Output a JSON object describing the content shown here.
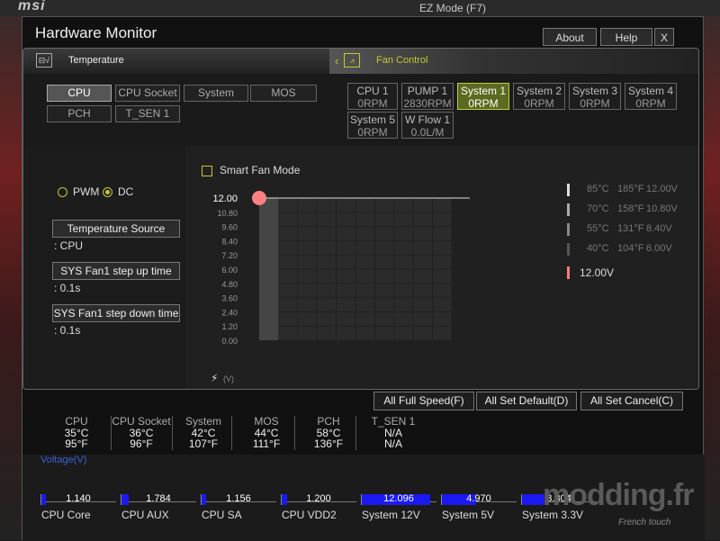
{
  "background": {
    "brand": "msi",
    "ezmode": "EZ Mode (F7)"
  },
  "window": {
    "title": "Hardware Monitor",
    "about": "About",
    "help": "Help",
    "close": "X"
  },
  "temperature_header": {
    "icon": "thermometer-icon",
    "label": "Temperature"
  },
  "fan_header": {
    "chevron": "‹",
    "label": "Fan Control"
  },
  "temp_sensors": [
    "CPU",
    "CPU Socket",
    "System",
    "MOS",
    "PCH",
    "T_SEN 1"
  ],
  "selected_temp_sensor": "CPU",
  "fans": [
    {
      "name": "CPU 1",
      "value": "0RPM"
    },
    {
      "name": "PUMP 1",
      "value": "2830RPM"
    },
    {
      "name": "System 1",
      "value": "0RPM"
    },
    {
      "name": "System 2",
      "value": "0RPM"
    },
    {
      "name": "System 3",
      "value": "0RPM"
    },
    {
      "name": "System 4",
      "value": "0RPM"
    },
    {
      "name": "System 5",
      "value": "0RPM"
    },
    {
      "name": "W Flow 1",
      "value": "0.0L/M"
    }
  ],
  "selected_fan": "System 1",
  "mode": {
    "pwm": "PWM",
    "dc": "DC",
    "selected": "DC"
  },
  "temperature_source": {
    "label": "Temperature Source",
    "value": ": CPU"
  },
  "step_up": {
    "label": "SYS Fan1 step up time",
    "value": ": 0.1s"
  },
  "step_down": {
    "label": "SYS Fan1 step down time",
    "value": ": 0.1s"
  },
  "smart_fan": {
    "label": "Smart Fan Mode",
    "checked": false
  },
  "chart_data": {
    "type": "line",
    "y_ticks": [
      "12.00",
      "10.80",
      "9.60",
      "8.40",
      "7.20",
      "6.00",
      "4.80",
      "3.60",
      "2.40",
      "1.20",
      "0.00"
    ],
    "ylim": [
      0,
      12
    ],
    "ylabel": "(V)",
    "point": {
      "y": 12.0
    },
    "legend": [
      {
        "c": "85°C",
        "f": "185°F",
        "v": "12.00V"
      },
      {
        "c": "70°C",
        "f": "158°F",
        "v": "10.80V"
      },
      {
        "c": "55°C",
        "f": "131°F",
        "v": "8.40V"
      },
      {
        "c": "40°C",
        "f": "104°F",
        "v": "6.00V"
      }
    ],
    "current_voltage": "12.00V",
    "grid": true
  },
  "bottom_buttons": {
    "full_speed": "All Full Speed(F)",
    "set_default": "All Set Default(D)",
    "set_cancel": "All Set Cancel(C)"
  },
  "temps": [
    {
      "name": "CPU",
      "c": "35°C",
      "f": "95°F"
    },
    {
      "name": "CPU Socket",
      "c": "36°C",
      "f": "96°F"
    },
    {
      "name": "System",
      "c": "42°C",
      "f": "107°F"
    },
    {
      "name": "MOS",
      "c": "44°C",
      "f": "111°F"
    },
    {
      "name": "PCH",
      "c": "58°C",
      "f": "136°F"
    },
    {
      "name": "T_SEN 1",
      "c": "N/A",
      "f": "N/A"
    }
  ],
  "voltage": {
    "title": "Voltage(V)",
    "items": [
      {
        "name": "CPU Core",
        "value": "1.140",
        "fraction": 0.06
      },
      {
        "name": "CPU AUX",
        "value": "1.784",
        "fraction": 0.1
      },
      {
        "name": "CPU SA",
        "value": "1.156",
        "fraction": 0.06
      },
      {
        "name": "CPU VDD2",
        "value": "1.200",
        "fraction": 0.07
      },
      {
        "name": "System 12V",
        "value": "12.096",
        "fraction": 0.91
      },
      {
        "name": "System 5V",
        "value": "4.970",
        "fraction": 0.45
      },
      {
        "name": "System 3.3V",
        "value": "3.304",
        "fraction": 0.3
      }
    ]
  },
  "watermark": {
    "text": "modding.fr",
    "sub": "French touch"
  }
}
